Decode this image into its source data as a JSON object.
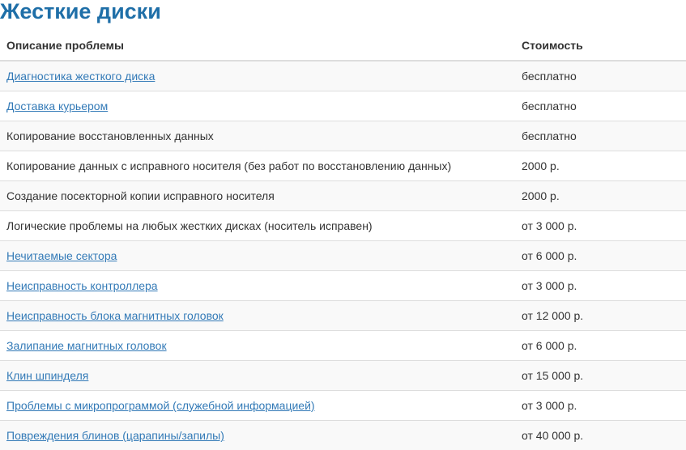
{
  "title": "Жесткие диски",
  "table": {
    "headers": [
      "Описание проблемы",
      "Стоимость"
    ],
    "rows": [
      {
        "label": "Диагностика жесткого диска",
        "price": "бесплатно",
        "link": true
      },
      {
        "label": "Доставка курьером",
        "price": "бесплатно",
        "link": true
      },
      {
        "label": "Копирование восстановленных данных",
        "price": "бесплатно",
        "link": false
      },
      {
        "label": "Копирование данных с исправного носителя (без работ по восстановлению данных)",
        "price": "2000 р.",
        "link": false
      },
      {
        "label": "Создание посекторной копии исправного носителя",
        "price": "2000 р.",
        "link": false
      },
      {
        "label": "Логические проблемы на любых жестких дисках (носитель исправен)",
        "price": "от 3 000 р.",
        "link": false
      },
      {
        "label": "Нечитаемые сектора",
        "price": "от 6 000 р.",
        "link": true
      },
      {
        "label": "Неисправность контроллера",
        "price": "от 3 000 р.",
        "link": true
      },
      {
        "label": "Неисправность блока магнитных головок",
        "price": "от 12 000 р.",
        "link": true
      },
      {
        "label": "Залипание магнитных головок",
        "price": "от 6 000 р.",
        "link": true
      },
      {
        "label": "Клин шпинделя",
        "price": "от 15 000 р.",
        "link": true
      },
      {
        "label": "Проблемы с микропрограммой (служебной информацией)",
        "price": "от 3 000 р.",
        "link": true
      },
      {
        "label": "Повреждения блинов (царапины/запилы)",
        "price": "от 40 000 р.",
        "link": true
      }
    ]
  },
  "colors": {
    "title": "#1f6fa8",
    "link": "#337ab7",
    "text": "#333333",
    "stripe": "#f9f9f9",
    "border": "#dddddd"
  }
}
